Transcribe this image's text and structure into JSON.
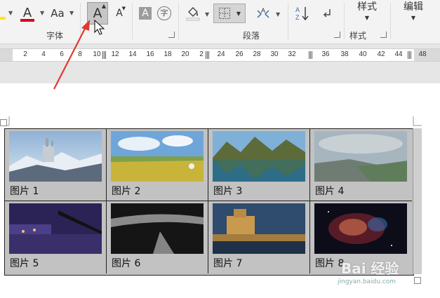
{
  "ribbon": {
    "font_group_label": "字体",
    "paragraph_group_label": "段落",
    "styles_group_label": "样式",
    "styles_button": "样式",
    "edit_button": "编辑",
    "change_case_label": "Aa",
    "font_color_letter": "A",
    "grow_font_letter": "A",
    "shrink_font_letter": "A",
    "char_shading_letter": "A",
    "enclose_char": "字",
    "sort_label": "A↓Z"
  },
  "ruler": {
    "numbers": [
      "2",
      "4",
      "6",
      "8",
      "10",
      "12",
      "14",
      "16",
      "18",
      "20",
      "2",
      "24",
      "26",
      "28",
      "30",
      "32",
      "36",
      "38",
      "40",
      "42",
      "44",
      "48"
    ]
  },
  "table": {
    "captions": [
      "图片 1",
      "图片 2",
      "图片 3",
      "图片 4",
      "图片 5",
      "图片 6",
      "图片 7",
      "图片 8"
    ]
  },
  "watermark": {
    "text": "Bai 经验",
    "url": "jingyan.baidu.com"
  },
  "colors": {
    "accent_red": "#e03a2f",
    "font_color_bar": "#d9001b",
    "ribbon_bg": "#f3f3f3"
  }
}
